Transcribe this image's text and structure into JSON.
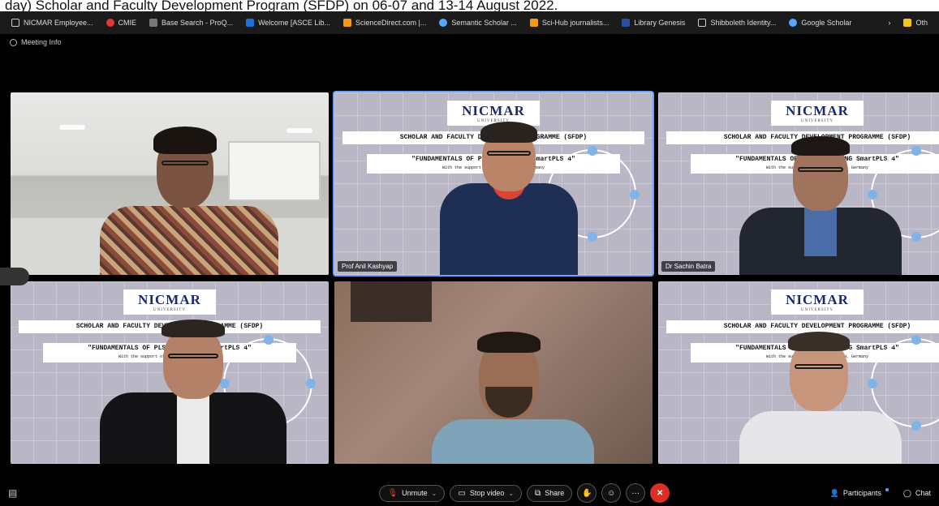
{
  "caption": "day) Scholar and Faculty Development Program (SFDP) on 06-07 and 13-14 August 2022.",
  "bookmarks": [
    {
      "label": "NICMAR Employee...",
      "icon": "page-icon"
    },
    {
      "label": "CMIE",
      "icon": "cmie-icon"
    },
    {
      "label": "Base Search - ProQ...",
      "icon": "proquest-icon"
    },
    {
      "label": "Welcome [ASCE Lib...",
      "icon": "asce-icon"
    },
    {
      "label": "ScienceDirect.com |...",
      "icon": "sciencedirect-icon"
    },
    {
      "label": "Semantic Scholar ...",
      "icon": "semantic-scholar-icon"
    },
    {
      "label": "Sci-Hub journalists...",
      "icon": "scihub-icon"
    },
    {
      "label": "Library Genesis",
      "icon": "libgen-icon"
    },
    {
      "label": "Shibboleth Identity...",
      "icon": "page-icon"
    },
    {
      "label": "Google Scholar",
      "icon": "google-scholar-icon"
    }
  ],
  "bookmarks_more": "Oth",
  "meeting_info": "Meeting Info",
  "slides": {
    "logo": "NICMAR",
    "logo_sub": "UNIVERSITY",
    "line1_full": "SCHOLAR AND FACULTY DEVELOPMENT PROGRAMME (SFDP)",
    "line2_full": "\"FUNDAMENTALS OF PLS-SEM USING SmartPLS 4\"",
    "line3": "With the support of SmartPLS GmbH, Germany"
  },
  "participants": [
    {
      "name": ""
    },
    {
      "name": "Prof Anil Kashyap"
    },
    {
      "name": "Dr Sachin Batra"
    },
    {
      "name": ""
    },
    {
      "name": ""
    },
    {
      "name": ""
    }
  ],
  "toolbar": {
    "unmute": "Unmute",
    "stop_video": "Stop video",
    "share": "Share",
    "participants": "Participants",
    "chat": "Chat"
  },
  "colors": {
    "accent": "#6aa3ff",
    "end_call": "#d93025",
    "background": "#000000"
  }
}
